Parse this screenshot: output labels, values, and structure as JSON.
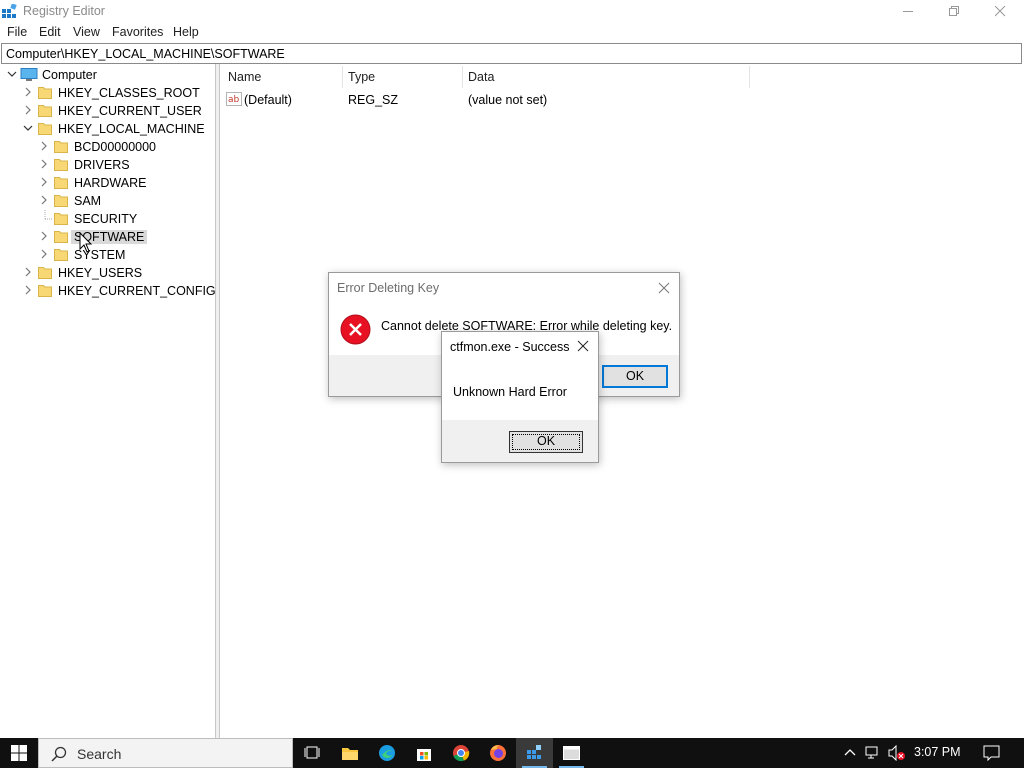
{
  "window": {
    "title": "Registry Editor",
    "controls": [
      "minimize",
      "maximize",
      "close"
    ]
  },
  "menu": [
    "File",
    "Edit",
    "View",
    "Favorites",
    "Help"
  ],
  "address": "Computer\\HKEY_LOCAL_MACHINE\\SOFTWARE",
  "tree": {
    "root": "Computer",
    "items": [
      {
        "label": "HKEY_CLASSES_ROOT",
        "expanded": false
      },
      {
        "label": "HKEY_CURRENT_USER",
        "expanded": false
      },
      {
        "label": "HKEY_LOCAL_MACHINE",
        "expanded": true
      },
      {
        "label": "BCD00000000",
        "expanded": false
      },
      {
        "label": "DRIVERS",
        "expanded": false
      },
      {
        "label": "HARDWARE",
        "expanded": false
      },
      {
        "label": "SAM",
        "expanded": false
      },
      {
        "label": "SECURITY",
        "expanded": false
      },
      {
        "label": "SOFTWARE",
        "expanded": false,
        "selected": true
      },
      {
        "label": "SYSTEM",
        "expanded": false
      },
      {
        "label": "HKEY_USERS",
        "expanded": false
      },
      {
        "label": "HKEY_CURRENT_CONFIG",
        "expanded": false
      }
    ]
  },
  "list": {
    "columns": {
      "name": "Name",
      "type": "Type",
      "data": "Data"
    },
    "rows": [
      {
        "name": "(Default)",
        "type": "REG_SZ",
        "data": "(value not set)"
      }
    ]
  },
  "error_dialog": {
    "title": "Error Deleting Key",
    "message": "Cannot delete SOFTWARE:  Error while deleting key.",
    "ok": "OK",
    "icon": "error-icon"
  },
  "hard_error_dialog": {
    "title": "ctfmon.exe - Success",
    "message": "Unknown Hard Error",
    "ok": "OK"
  },
  "taskbar": {
    "search_placeholder": "Search",
    "apps": [
      "task-view",
      "file-explorer",
      "edge",
      "store",
      "chrome",
      "firefox",
      "registry-editor",
      "window"
    ],
    "clock": "3:07 PM"
  },
  "colors": {
    "accent": "#0078d7",
    "error_red": "#e81123",
    "folder_yellow": "#f8d775",
    "taskbar": "#101010"
  }
}
